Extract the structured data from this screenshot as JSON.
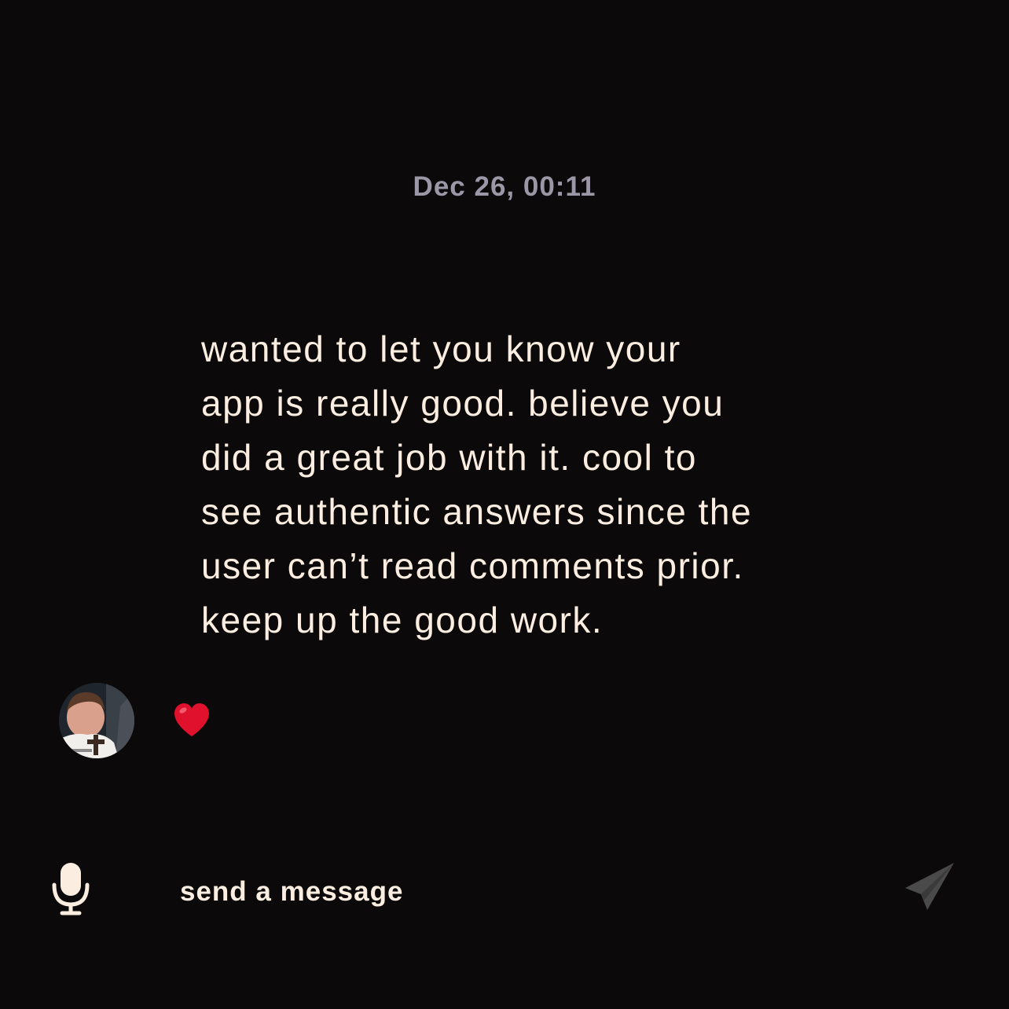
{
  "conversation": {
    "timestamp": "Dec 26, 00:11",
    "message": {
      "text": "wanted to let you know your\napp is really good. believe you\ndid a great job with it. cool to\nsee authentic answers since the\nuser can’t read comments prior.\nkeep up the good work."
    },
    "reaction": {
      "avatar": "user-avatar",
      "emoji_icon": "red-heart-icon"
    }
  },
  "composer": {
    "mic_icon": "microphone-icon",
    "placeholder": "send a message",
    "value": "",
    "send_icon": "paper-plane-send-icon"
  },
  "colors": {
    "background": "#0b0909",
    "text": "#fbeee0",
    "timestamp": "#9c97a6",
    "heart": "#e0112c",
    "send_icon_disabled": "#4a4a4a"
  }
}
